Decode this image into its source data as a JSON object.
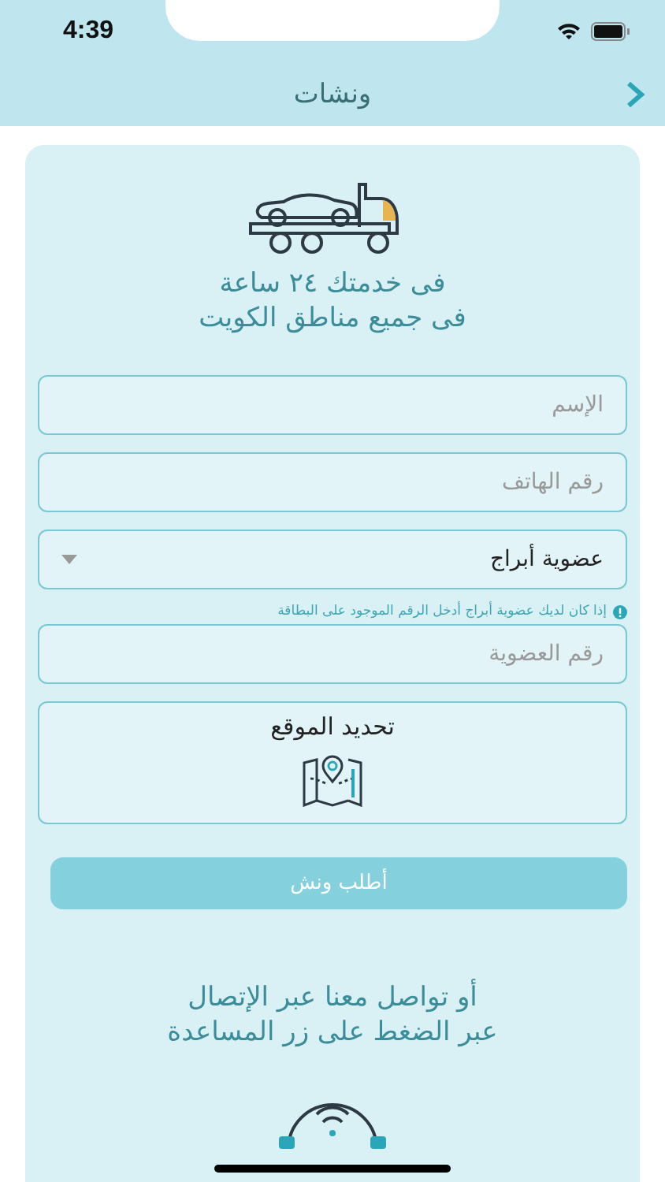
{
  "status_bar": {
    "time": "4:39"
  },
  "nav": {
    "title": "ونشات"
  },
  "hero": {
    "lines": [
      "فى خدمتك ٢٤ ساعة",
      "فى جميع مناطق الكويت"
    ]
  },
  "fields": [
    {
      "kind": "text",
      "placeholder": "الإسم"
    },
    {
      "kind": "text",
      "placeholder": "رقم الهاتف"
    },
    {
      "kind": "select",
      "value": "عضوية أبراج"
    }
  ],
  "hint": "إذا كان لديك عضوية أبراج أدخل الرقم الموجود على البطاقة",
  "membership_field": {
    "placeholder": "رقم العضوية"
  },
  "location": {
    "label": "تحديد الموقع"
  },
  "submit_button": {
    "label": "أطلب ونش",
    "disabled": true
  },
  "contact": {
    "lines": [
      "أو تواصل معنا عبر الإتصال",
      "عبر الضغط على زر المساعدة"
    ]
  }
}
